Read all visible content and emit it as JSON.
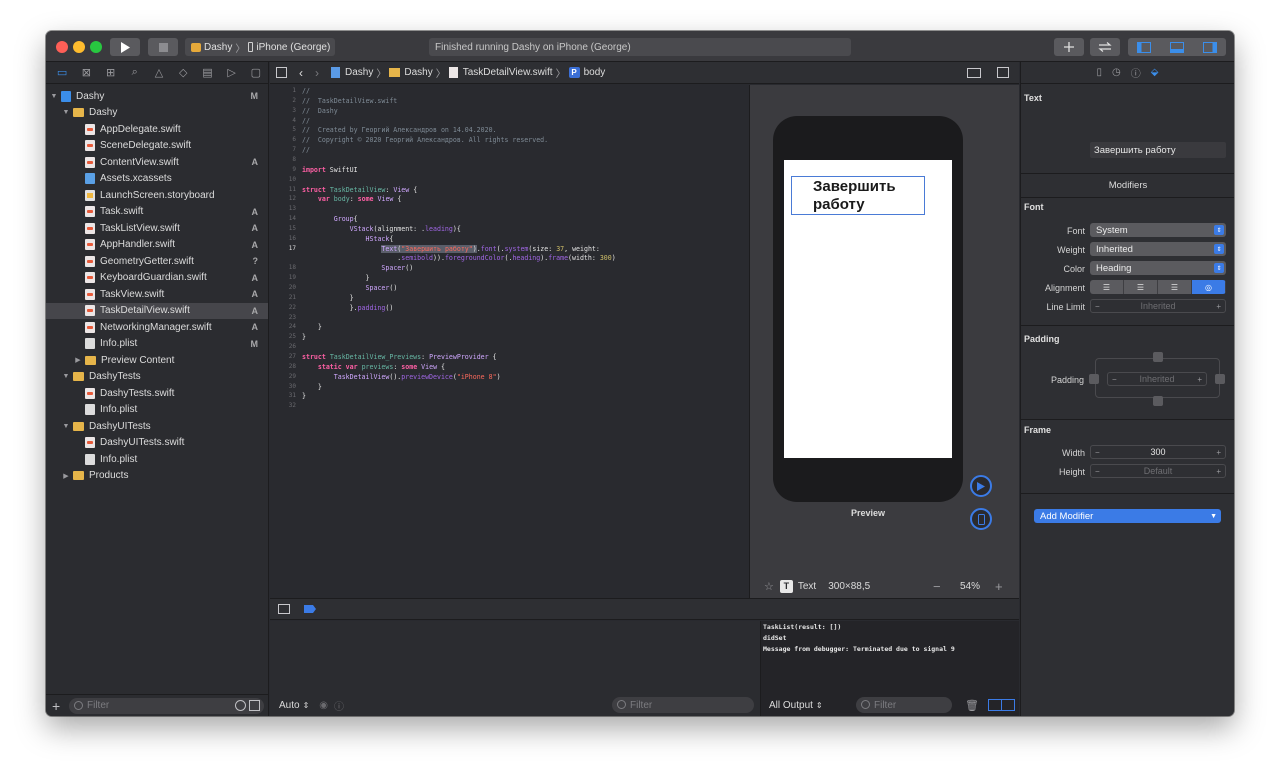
{
  "toolbar": {
    "scheme_app": "Dashy",
    "scheme_device": "iPhone (George)",
    "status_text": "Finished running Dashy on iPhone (George)",
    "play_icon": "play-icon",
    "stop_icon": "stop-icon",
    "add_icon": "plus-icon",
    "swap_icon": "swap-icon"
  },
  "navigator": {
    "filter_placeholder": "Filter",
    "items": [
      {
        "name": "Dashy",
        "kind": "proj",
        "indent": 0,
        "disclosure": "▼",
        "badge": "M"
      },
      {
        "name": "Dashy",
        "kind": "folder",
        "indent": 1,
        "disclosure": "▼",
        "badge": ""
      },
      {
        "name": "AppDelegate.swift",
        "kind": "swift",
        "indent": 2,
        "disclosure": "",
        "badge": ""
      },
      {
        "name": "SceneDelegate.swift",
        "kind": "swift",
        "indent": 2,
        "disclosure": "",
        "badge": ""
      },
      {
        "name": "ContentView.swift",
        "kind": "swift",
        "indent": 2,
        "disclosure": "",
        "badge": "A"
      },
      {
        "name": "Assets.xcassets",
        "kind": "assets",
        "indent": 2,
        "disclosure": "",
        "badge": ""
      },
      {
        "name": "LaunchScreen.storyboard",
        "kind": "story",
        "indent": 2,
        "disclosure": "",
        "badge": ""
      },
      {
        "name": "Task.swift",
        "kind": "swift",
        "indent": 2,
        "disclosure": "",
        "badge": "A"
      },
      {
        "name": "TaskListView.swift",
        "kind": "swift",
        "indent": 2,
        "disclosure": "",
        "badge": "A"
      },
      {
        "name": "AppHandler.swift",
        "kind": "swift",
        "indent": 2,
        "disclosure": "",
        "badge": "A"
      },
      {
        "name": "GeometryGetter.swift",
        "kind": "swift",
        "indent": 2,
        "disclosure": "",
        "badge": "?"
      },
      {
        "name": "KeyboardGuardian.swift",
        "kind": "swift",
        "indent": 2,
        "disclosure": "",
        "badge": "A"
      },
      {
        "name": "TaskView.swift",
        "kind": "swift",
        "indent": 2,
        "disclosure": "",
        "badge": "A"
      },
      {
        "name": "TaskDetailView.swift",
        "kind": "swift",
        "indent": 2,
        "disclosure": "",
        "badge": "A",
        "selected": true
      },
      {
        "name": "NetworkingManager.swift",
        "kind": "swift",
        "indent": 2,
        "disclosure": "",
        "badge": "A"
      },
      {
        "name": "Info.plist",
        "kind": "plist",
        "indent": 2,
        "disclosure": "",
        "badge": "M"
      },
      {
        "name": "Preview Content",
        "kind": "folder",
        "indent": 2,
        "disclosure": "▶",
        "badge": ""
      },
      {
        "name": "DashyTests",
        "kind": "folder",
        "indent": 1,
        "disclosure": "▼",
        "badge": ""
      },
      {
        "name": "DashyTests.swift",
        "kind": "swift",
        "indent": 2,
        "disclosure": "",
        "badge": ""
      },
      {
        "name": "Info.plist",
        "kind": "plist",
        "indent": 2,
        "disclosure": "",
        "badge": ""
      },
      {
        "name": "DashyUITests",
        "kind": "folder",
        "indent": 1,
        "disclosure": "▼",
        "badge": ""
      },
      {
        "name": "DashyUITests.swift",
        "kind": "swift",
        "indent": 2,
        "disclosure": "",
        "badge": ""
      },
      {
        "name": "Info.plist",
        "kind": "plist",
        "indent": 2,
        "disclosure": "",
        "badge": ""
      },
      {
        "name": "Products",
        "kind": "folder",
        "indent": 1,
        "disclosure": "▶",
        "badge": ""
      }
    ]
  },
  "jumpbar": {
    "crumbs": [
      "Dashy",
      "Dashy",
      "TaskDetailView.swift",
      "body"
    ],
    "symbol_badge": "P"
  },
  "editor": {
    "lines": [
      {
        "n": "1",
        "html": "<span class='cm'>//</span>"
      },
      {
        "n": "2",
        "html": "<span class='cm'>//  TaskDetailView.swift</span>"
      },
      {
        "n": "3",
        "html": "<span class='cm'>//  Dashy</span>"
      },
      {
        "n": "4",
        "html": "<span class='cm'>//</span>"
      },
      {
        "n": "5",
        "html": "<span class='cm'>//  Created by Георгий Александров on 14.04.2020.</span>"
      },
      {
        "n": "6",
        "html": "<span class='cm'>//  Copyright © 2020 Георгий Александров. All rights reserved.</span>"
      },
      {
        "n": "7",
        "html": "<span class='cm'>//</span>"
      },
      {
        "n": "8",
        "html": ""
      },
      {
        "n": "9",
        "html": "<span class='kw'>import</span> SwiftUI"
      },
      {
        "n": "10",
        "html": ""
      },
      {
        "n": "11",
        "html": "<span class='kw'>struct</span> <span class='id'>TaskDetailView</span>: <span class='ty'>View</span> {"
      },
      {
        "n": "12",
        "html": "    <span class='kw'>var</span> <span class='id'>body</span>: <span class='kw'>some</span> <span class='ty'>View</span> {"
      },
      {
        "n": "13",
        "html": ""
      },
      {
        "n": "14",
        "html": "        <span class='ty'>Group</span>{"
      },
      {
        "n": "15",
        "html": "            <span class='ty'>VStack</span>(alignment: .<span class='fn'>leading</span>){"
      },
      {
        "n": "16",
        "html": "                <span class='ty'>HStack</span>{"
      },
      {
        "n": "17",
        "html": "                    <span class='hl'><span class='ty'>Text</span>(<span class='st'>\"Завершить работу\"</span>)</span>.<span class='fn'>font</span>(.<span class='fn'>system</span>(size: <span class='nm'>37</span>, weight:"
      },
      {
        "n": "",
        "html": "                        .<span class='fn'>semibold</span>)).<span class='fn'>foregroundColor</span>(.<span class='fn'>heading</span>).<span class='fn'>frame</span>(width: <span class='nm'>300</span>)"
      },
      {
        "n": "18",
        "html": "                    <span class='ty'>Spacer</span>()"
      },
      {
        "n": "19",
        "html": "                }"
      },
      {
        "n": "20",
        "html": "                <span class='ty'>Spacer</span>()"
      },
      {
        "n": "21",
        "html": "            }"
      },
      {
        "n": "22",
        "html": "            }.<span class='fn'>padding</span>()"
      },
      {
        "n": "23",
        "html": ""
      },
      {
        "n": "24",
        "html": "    }"
      },
      {
        "n": "25",
        "html": "}"
      },
      {
        "n": "26",
        "html": ""
      },
      {
        "n": "27",
        "html": "<span class='kw'>struct</span> <span class='id'>TaskDetailView_Previews</span>: <span class='ty'>PreviewProvider</span> {"
      },
      {
        "n": "28",
        "html": "    <span class='kw'>static var</span> <span class='id'>previews</span>: <span class='kw'>some</span> <span class='ty'>View</span> {"
      },
      {
        "n": "29",
        "html": "        <span class='ty'>TaskDetailView</span>().<span class='fn'>previewDevice</span>(<span class='st'>\"iPhone 8\"</span>)"
      },
      {
        "n": "30",
        "html": "    }"
      },
      {
        "n": "31",
        "html": "}"
      },
      {
        "n": "32",
        "html": ""
      }
    ]
  },
  "canvas": {
    "preview_text": "Завершить работу",
    "preview_label": "Preview",
    "selection_kind": "Text",
    "selection_size": "300×88,5",
    "zoom": "54%"
  },
  "debug": {
    "auto_label": "Auto",
    "filter_placeholder": "Filter",
    "output_label": "All Output",
    "console": [
      "TaskList(result: [])",
      "didSet",
      "Message from debugger: Terminated due to signal 9"
    ]
  },
  "inspector": {
    "text_section": "Text",
    "text_value": "Завершить работу",
    "modifiers_title": "Modifiers",
    "font_section": "Font",
    "font_label": "Font",
    "font_value": "System",
    "weight_label": "Weight",
    "weight_value": "Inherited",
    "color_label": "Color",
    "color_value": "Heading",
    "alignment_label": "Alignment",
    "line_limit_label": "Line Limit",
    "line_limit_value": "Inherited",
    "padding_section": "Padding",
    "padding_label": "Padding",
    "padding_value": "Inherited",
    "frame_section": "Frame",
    "width_label": "Width",
    "width_value": "300",
    "height_label": "Height",
    "height_value": "Default",
    "add_modifier": "Add Modifier"
  }
}
